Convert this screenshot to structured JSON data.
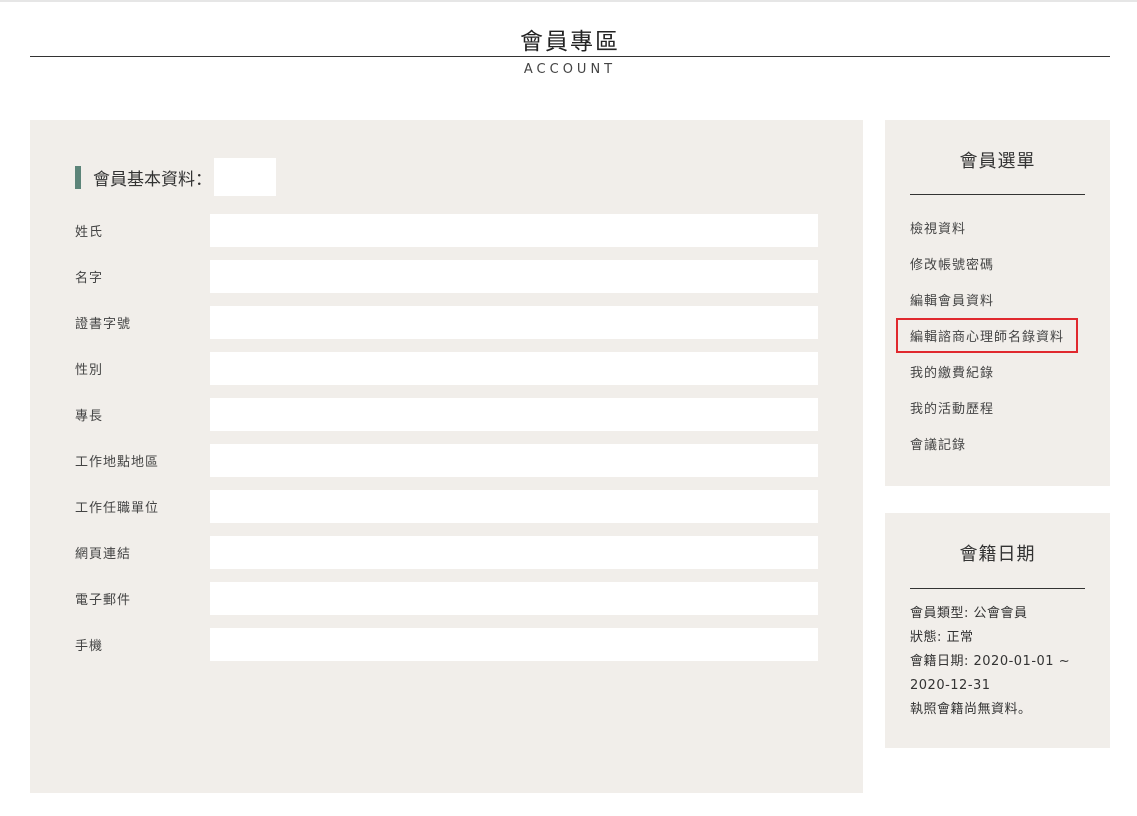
{
  "header": {
    "title": "會員專區",
    "subtitle": "ACCOUNT"
  },
  "profile": {
    "heading": "會員基本資料："
  },
  "form": {
    "fields": [
      {
        "label": "姓氏",
        "value": ""
      },
      {
        "label": "名字",
        "value": ""
      },
      {
        "label": "證書字號",
        "value": ""
      },
      {
        "label": "性別",
        "value": ""
      },
      {
        "label": "專長",
        "value": ""
      },
      {
        "label": "工作地點地區",
        "value": ""
      },
      {
        "label": "工作任職單位",
        "value": ""
      },
      {
        "label": "網頁連結",
        "value": ""
      },
      {
        "label": "電子郵件",
        "value": ""
      },
      {
        "label": "手機",
        "value": ""
      }
    ]
  },
  "menu": {
    "title": "會員選單",
    "items": [
      {
        "label": "檢視資料"
      },
      {
        "label": "修改帳號密碼"
      },
      {
        "label": "編輯會員資料"
      },
      {
        "label": "編輯諮商心理師名錄資料"
      },
      {
        "label": "我的繳費紀錄"
      },
      {
        "label": "我的活動歷程"
      },
      {
        "label": "會議記錄"
      }
    ],
    "highlighted_item": "編輯諮商心理師名錄資料"
  },
  "membership": {
    "title": "會籍日期",
    "type_line": "會員類型: 公會會員",
    "status_line": "狀態: 正常",
    "date_line": "會籍日期: 2020-01-01 ~ 2020-12-31",
    "license_line": "執照會籍尚無資料。"
  },
  "colors": {
    "panel_bg": "#f1eeea",
    "accent_bar": "#5c8479",
    "highlight_border": "#e0282e"
  }
}
